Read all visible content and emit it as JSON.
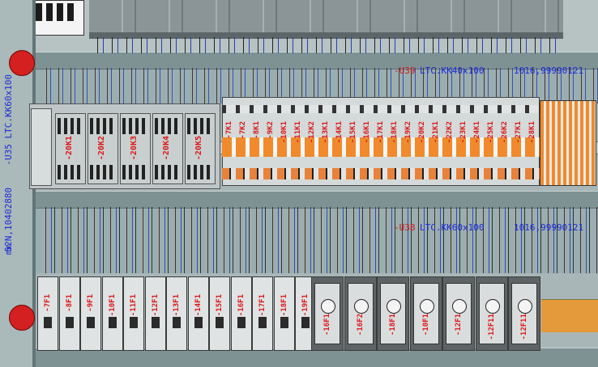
{
  "labels": {
    "left_duct": "-U35  LTC.KK60x100",
    "left_part": "52N,10402880",
    "left_unit": "mm",
    "duct_upper_ref": "-U39",
    "duct_upper_type": "LTC.KK40x100",
    "duct_upper_part": "1016,99990121",
    "duct_lower_ref": "-U38",
    "duct_lower_type": "LTC.KK60x100",
    "duct_lower_part": "1016,99990121"
  },
  "relays": [
    "-20K1",
    "-20K2",
    "-20K3",
    "-20K4",
    "-20K5"
  ],
  "terminals": [
    "-7K1",
    "-7K2",
    "-8K1",
    "-9K2",
    "-10K1",
    "-11K1",
    "-12K2",
    "-13K1",
    "-14K1",
    "-15K1",
    "-16K1",
    "-17K1",
    "-18K1",
    "-19K2",
    "-20K2",
    "-21K1",
    "-22K2",
    "-23K1",
    "-24K1",
    "-25K1",
    "-26K2",
    "-27K1",
    "-28K1"
  ],
  "breakers_small": [
    "-7F1",
    "-8F1",
    "-9F1",
    "-10F1",
    "-11F1",
    "-12F1",
    "-13F1",
    "-14F1",
    "-15F1",
    "-16F1",
    "-17F1",
    "-18F1",
    "-19F1"
  ],
  "breakers_large": [
    "-16F1",
    "-16F2",
    "-18F1",
    "-10F1",
    "-12F1",
    "-12F11",
    "-12F11"
  ],
  "colors": {
    "duct": "#7e9294",
    "label_blue": "#1a2ad8",
    "label_red": "#e01515",
    "terminal_orange": "#f08a2c",
    "marker": "#d42020"
  }
}
